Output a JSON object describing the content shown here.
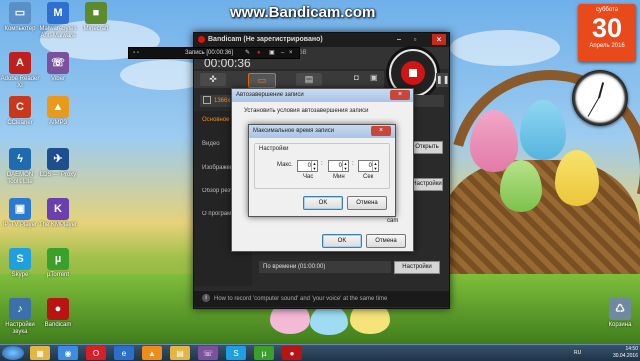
{
  "watermark": "www.Bandicam.com",
  "desktop_icons": [
    {
      "label": "Компьютер",
      "icon": "computer-icon",
      "color": "#5b8fc7",
      "glyph": "▭"
    },
    {
      "label": "Malwarebytes Anti-Malware",
      "icon": "malwarebytes-icon",
      "color": "#2f6fd0",
      "glyph": "M"
    },
    {
      "label": "Minecraft",
      "icon": "minecraft-icon",
      "color": "#5c8b2c",
      "glyph": "■"
    },
    {
      "label": "Adobe Reader XI",
      "icon": "adobe-reader-icon",
      "color": "#c0201d",
      "glyph": "A"
    },
    {
      "label": "Viber",
      "icon": "viber-icon",
      "color": "#7b519d",
      "glyph": "☏"
    },
    {
      "label": "CCleaner",
      "icon": "ccleaner-icon",
      "color": "#c8381d",
      "glyph": "C"
    },
    {
      "label": "AIMP3",
      "icon": "aimp-icon",
      "color": "#e79a1b",
      "glyph": "▲"
    },
    {
      "label": "DAEMON Tools Lite",
      "icon": "daemon-tools-icon",
      "color": "#1f6bb0",
      "glyph": "ϟ"
    },
    {
      "label": "LDS — Proxy",
      "icon": "lds-proxy-icon",
      "color": "#1d4f8f",
      "glyph": "✈"
    },
    {
      "label": "IP-TV Player",
      "icon": "iptv-icon",
      "color": "#2a7bd0",
      "glyph": "▣"
    },
    {
      "label": "The KMPlayer",
      "icon": "kmplayer-icon",
      "color": "#6a3fb0",
      "glyph": "K"
    },
    {
      "label": "Skype",
      "icon": "skype-icon",
      "color": "#1ea0e0",
      "glyph": "S"
    },
    {
      "label": "µTorrent",
      "icon": "utorrent-icon",
      "color": "#3ba02a",
      "glyph": "µ"
    },
    {
      "label": "Настройки звука",
      "icon": "sound-settings-icon",
      "color": "#3d6fa8",
      "glyph": "♪"
    },
    {
      "label": "Bandicam",
      "icon": "bandicam-icon",
      "color": "#b81414",
      "glyph": "●"
    },
    {
      "label": "Корзина",
      "icon": "recycle-bin-icon",
      "color": "#6f8aa0",
      "glyph": "♺"
    }
  ],
  "calendar": {
    "weekday": "суббота",
    "day": "30",
    "month": "Апрель 2016"
  },
  "mini_toolbar": {
    "label": "Запись [00:00:36]"
  },
  "bandicam": {
    "title": "Bandicam (Не зарегистрировано)",
    "file_size": "3.2MB / 99.9GB",
    "timer": "00:00:36",
    "tab_icons": [
      "gamepad-icon",
      "rectangle-icon",
      "hdmi-icon"
    ],
    "folder_label": "1366x",
    "side_items": [
      "Основное",
      "Видео",
      "Изображение",
      "Обзор результатов",
      "О программе"
    ],
    "open_button": "Открыть",
    "bottom_row": "По времени (01:00:00)",
    "settings_button": "Настройки",
    "footer": "How to record 'computer sound' and 'your voice' at the same time"
  },
  "auto_dialog": {
    "title": "Автозавершение записи",
    "text": "Установить условия автозавершения записи",
    "ok": "OK",
    "cancel": "Отмена",
    "under_text": "cam"
  },
  "max_dialog": {
    "title": "Максимальное время записи",
    "group": "Настройки",
    "max_label": "Макс.",
    "hours": "0",
    "minutes": "0",
    "seconds": "0",
    "hours_label": "Час",
    "minutes_label": "Мин",
    "seconds_label": "Сек",
    "ok": "OK",
    "cancel": "Отмена"
  },
  "taskbar": {
    "apps": [
      "explorer-icon",
      "chrome-icon",
      "opera-icon",
      "ie-icon",
      "vlc-icon",
      "folder-icon",
      "viber-icon",
      "skype-icon",
      "utorrent-icon",
      "bandicam-icon"
    ],
    "language": "RU",
    "time": "14:50",
    "date": "30.04.2016"
  }
}
